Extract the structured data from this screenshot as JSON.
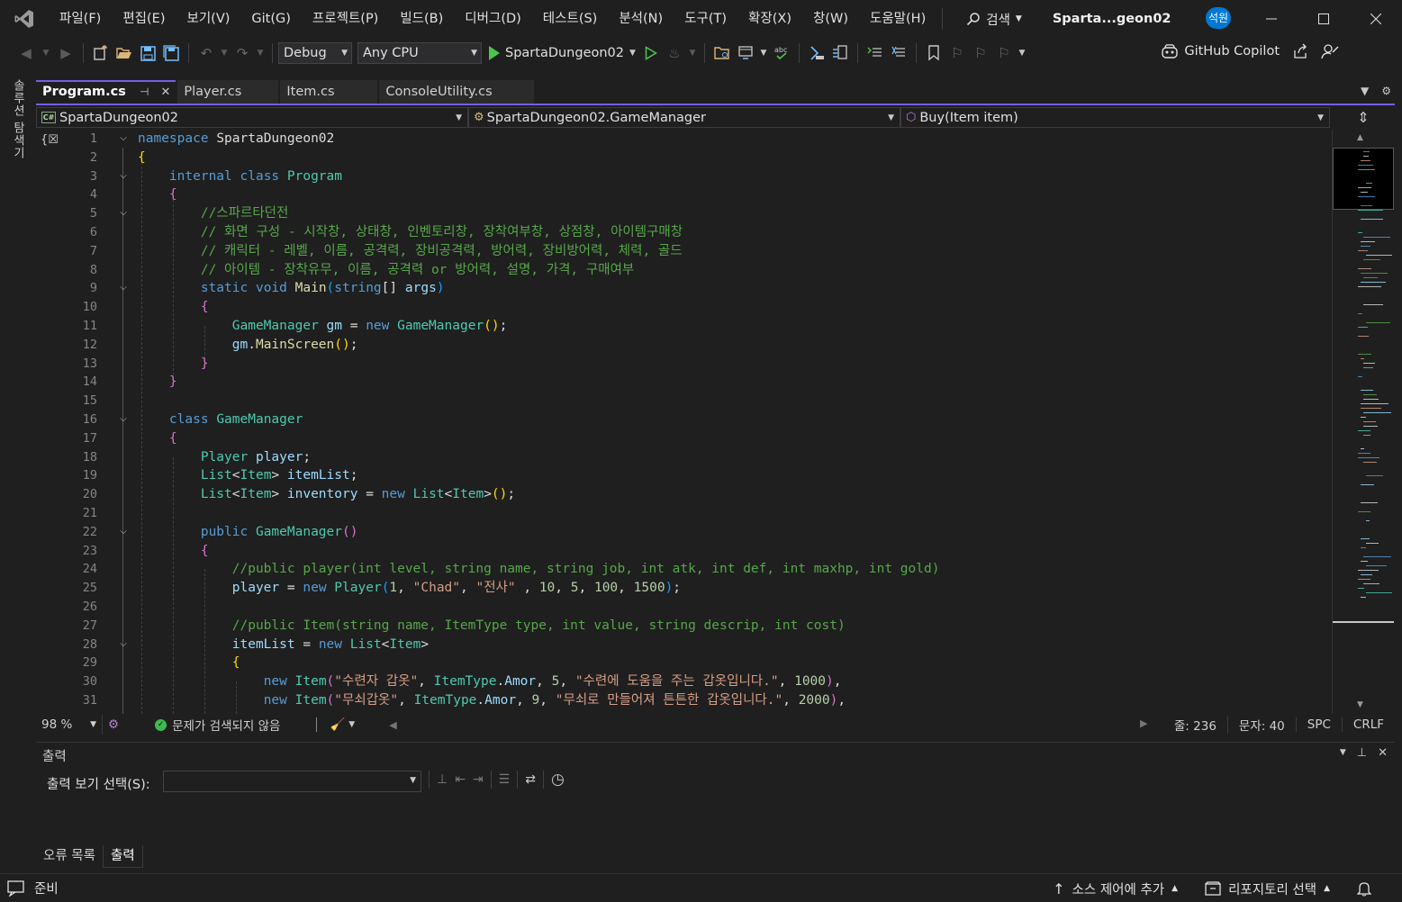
{
  "menu": {
    "items": [
      "파일(F)",
      "편집(E)",
      "보기(V)",
      "Git(G)",
      "프로젝트(P)",
      "빌드(B)",
      "디버그(D)",
      "테스트(S)",
      "분석(N)",
      "도구(T)",
      "확장(X)",
      "창(W)",
      "도움말(H)"
    ],
    "search_label": "검색",
    "solution_title": "Sparta...geon02",
    "user_initials": "석원"
  },
  "toolbar": {
    "config": "Debug",
    "platform": "Any CPU",
    "start_target": "SpartaDungeon02",
    "copilot_label": "GitHub Copilot"
  },
  "left_strip": {
    "label": "솔루션 탐색기"
  },
  "tabs": [
    {
      "label": "Program.cs",
      "active": true
    },
    {
      "label": "Player.cs",
      "active": false
    },
    {
      "label": "Item.cs",
      "active": false
    },
    {
      "label": "ConsoleUtility.cs",
      "active": false
    }
  ],
  "navbar": {
    "project": "SpartaDungeon02",
    "type": "SpartaDungeon02.GameManager",
    "member": "Buy(Item item)"
  },
  "code": {
    "line_numbers": [
      "1",
      "2",
      "3",
      "4",
      "5",
      "6",
      "7",
      "8",
      "9",
      "10",
      "11",
      "12",
      "13",
      "14",
      "15",
      "16",
      "17",
      "18",
      "19",
      "20",
      "21",
      "22",
      "23",
      "24",
      "25",
      "26",
      "27",
      "28",
      "29",
      "30",
      "31"
    ],
    "comment_line_5": "//스파르타던전",
    "comment_line_6": "// 화면 구성 - 시작창, 상태창, 인벤토리창, 장착여부창, 상점창, 아이템구매창",
    "comment_line_7": "// 캐릭터 - 레벨, 이름, 공격력, 장비공격력, 방어력, 장비방어력, 체력, 골드",
    "comment_line_8": "// 아이템 - 장착유무, 이름, 공격력 or 방어력, 설명, 가격, 구매여부",
    "comment_line_24": "//public player(int level, string name, string job, int atk, int def, int maxhp, int gold)",
    "comment_line_27": "//public Item(string name, ItemType type, int value, string descrip, int cost)",
    "str_chad": "\"Chad\"",
    "str_warrior": "\"전사\"",
    "str_item1_name": "\"수련자 갑옷\"",
    "str_item1_desc": "\"수련에 도움을 주는 갑옷입니다.\"",
    "str_item2_name": "\"무쇠갑옷\"",
    "str_item2_desc": "\"무쇠로 만들어져 튼튼한 갑옷입니다.\""
  },
  "editor_status": {
    "zoom": "98 %",
    "issues": "문제가 검색되지 않음",
    "line": "줄: 236",
    "col": "문자: 40",
    "whitespace": "SPC",
    "eol": "CRLF"
  },
  "output": {
    "title": "출력",
    "source_label": "출력 보기 선택(S):",
    "source_value": ""
  },
  "bottom_tabs": [
    "오류 목록",
    "출력"
  ],
  "statusbar": {
    "ready": "준비",
    "source_control": "소스 제어에 추가",
    "repository": "리포지토리 선택"
  },
  "colors": {
    "accent": "#7160e8",
    "keyword": "#569cd6",
    "type": "#4ec9b0",
    "comment": "#57a64a",
    "string": "#d69d85",
    "number": "#b5cea8",
    "method": "#dcdcaa",
    "variable": "#9cdcfe",
    "play_green": "#4ec34e",
    "ok_green": "#3fb950",
    "user_badge": "#0078d4"
  }
}
